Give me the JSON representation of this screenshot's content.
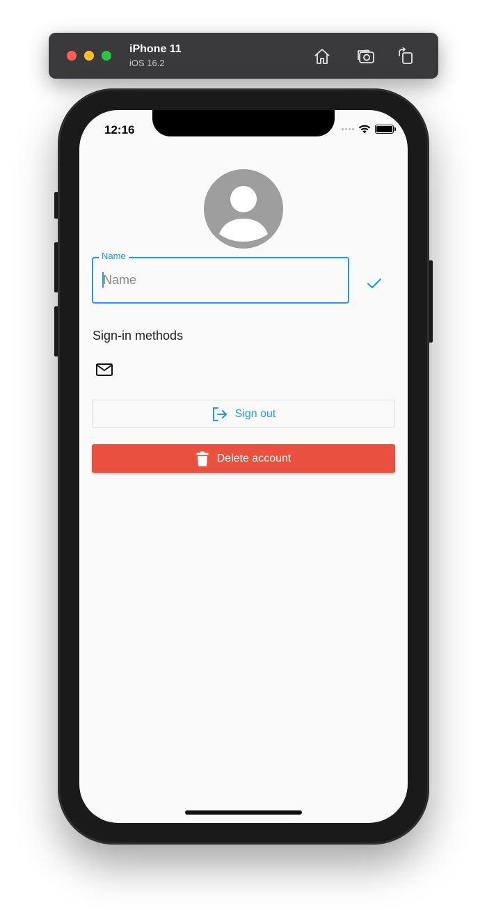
{
  "simulator": {
    "device": "iPhone 11",
    "os": "iOS 16.2",
    "colors": {
      "close": "#ff5f57",
      "minimize": "#febc2e",
      "zoom": "#28c840"
    },
    "icons": [
      "home-icon",
      "screenshot-icon",
      "rotate-icon"
    ]
  },
  "status_bar": {
    "time": "12:16",
    "icons": [
      "signal-dots-icon",
      "wifi-icon",
      "battery-icon"
    ]
  },
  "profile": {
    "avatar_icon": "person-icon",
    "name_field": {
      "label": "Name",
      "value": "",
      "placeholder": "Name"
    },
    "confirm_icon": "checkmark-icon",
    "sign_in_methods_label": "Sign-in methods",
    "sign_in_methods": [
      {
        "icon": "mail-icon"
      }
    ]
  },
  "actions": {
    "sign_out_label": "Sign out",
    "delete_label": "Delete account"
  },
  "colors": {
    "primary": "#2196f3",
    "danger": "#e8503f",
    "avatar": "#9e9e9e",
    "background": "#fafafa"
  }
}
